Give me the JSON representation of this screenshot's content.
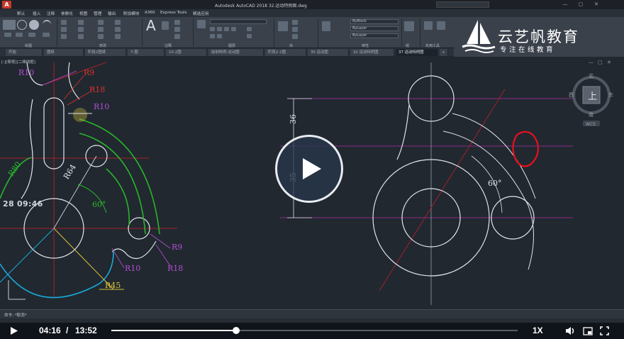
{
  "titlebar": {
    "logo_letter": "A",
    "document_title": "Autodesk AutoCAD 2018    32.运动特例图.dwg"
  },
  "menubar": {
    "items": [
      "默认",
      "插入",
      "注释",
      "参数化",
      "视图",
      "管理",
      "输出",
      "附加模块",
      "A360",
      "Express Tools",
      "精选应用"
    ]
  },
  "ribbon": {
    "panel_labels": [
      "绘图",
      "修改",
      "注释",
      "图层",
      "块",
      "特性",
      "组",
      "实用工具"
    ],
    "layer_value": "ByBlock",
    "bylayer_1": "ByLayer",
    "bylayer_2": "ByLayer",
    "text_tool_label": "A"
  },
  "brand": {
    "name": "云艺帆教育",
    "slogan": "专注在线教育"
  },
  "tabs": [
    {
      "label": "开始",
      "active": false
    },
    {
      "label": "图纸",
      "active": false
    },
    {
      "label": "阶段2图纸",
      "active": false
    },
    {
      "label": "7-图",
      "active": false
    },
    {
      "label": "10-2图",
      "active": false
    },
    {
      "label": "绘制特例-运动图",
      "active": false
    },
    {
      "label": "阶段2-2图",
      "active": false
    },
    {
      "label": "30 运动图",
      "active": false
    },
    {
      "label": "32 运动特例图",
      "active": false
    },
    {
      "label": "37 运动特例图",
      "active": true
    }
  ],
  "viewport": {
    "label": "[-][俯视][二维线框]"
  },
  "drawing_left": {
    "labels": {
      "r10_top": "R10",
      "r9_top": "R9",
      "r18_top": "R18",
      "r10_mid": "R10",
      "r80": "R80",
      "r64": "R64",
      "angle": "60°",
      "r9_bot": "R9",
      "r10_bot": "R10",
      "r18_bot": "R18",
      "r45": "R45"
    }
  },
  "drawing_right": {
    "dim_36": "36",
    "dim_35": "35",
    "angle": "60°"
  },
  "viewcube": {
    "north": "北",
    "south": "南",
    "east": "东",
    "west": "西",
    "face": "上",
    "wcs": "WCS"
  },
  "watermark": "28 09:46",
  "command": {
    "text": "命令: *取消*"
  },
  "player": {
    "current_time": "04:16",
    "separator": "/",
    "total_time": "13:52",
    "progress": 0.307,
    "speed_label": "1X"
  },
  "colors": {
    "red_labels": "#e0302e",
    "magenta_labels": "#b34fd2",
    "green_arcs": "#2ab52a",
    "cyan_arc": "#19a9d6",
    "yellow": "#d9c23a",
    "annotation_circle": "#e8101e"
  }
}
